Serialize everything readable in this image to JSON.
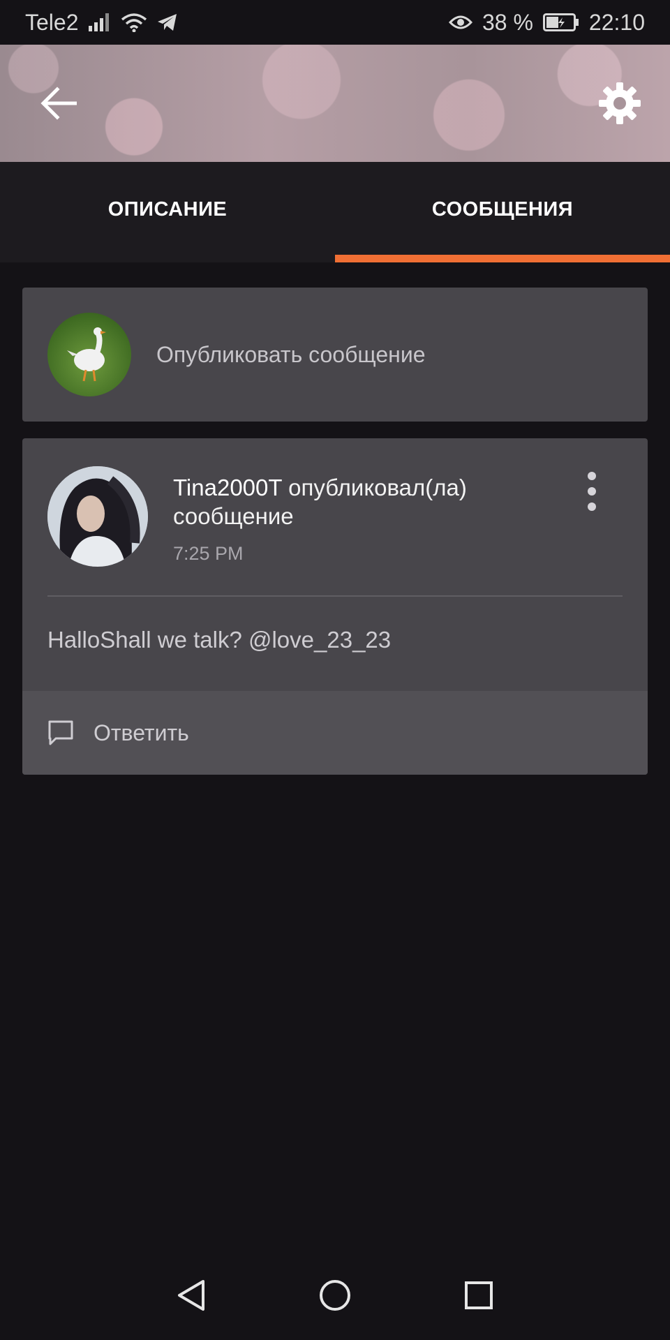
{
  "status_bar": {
    "carrier": "Tele2",
    "battery": "38 %",
    "time": "22:10",
    "icons": [
      "signal-icon",
      "wifi-icon",
      "telegram-icon",
      "eye-icon",
      "battery-icon"
    ]
  },
  "header": {
    "back_icon": "arrow-left-icon",
    "settings_icon": "gear-icon"
  },
  "tabs": [
    {
      "label": "ОПИСАНИЕ",
      "active": false
    },
    {
      "label": "СООБЩЕНИЯ",
      "active": true
    }
  ],
  "accent_color": "#f06f34",
  "compose": {
    "placeholder": "Опубликовать сообщение"
  },
  "post": {
    "author": "Tina2000T",
    "action": " опубликовал(ла) сообщение",
    "time": "7:25 PM",
    "body": "HalloShall we talk? @love_23_23",
    "reply_label": "Ответить"
  },
  "nav_bar": {
    "icons": [
      "back-triangle-icon",
      "home-circle-icon",
      "recents-square-icon"
    ]
  }
}
